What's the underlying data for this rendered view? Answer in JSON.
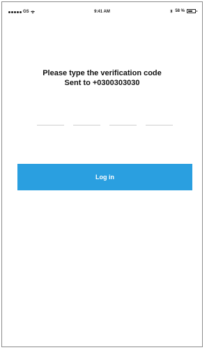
{
  "status_bar": {
    "carrier": "GS",
    "time": "9:41 AM",
    "battery_text": "58 %",
    "icons": [
      "signal-dots-icon",
      "wifi-icon",
      "bluetooth-icon",
      "battery-icon"
    ]
  },
  "verification": {
    "title": "Please type the verification code",
    "subtitle": "Sent to +0300303030",
    "code_length": 4
  },
  "login_button": {
    "label": "Log in",
    "background": "#2a9fe0",
    "text_color": "#ffffff"
  }
}
